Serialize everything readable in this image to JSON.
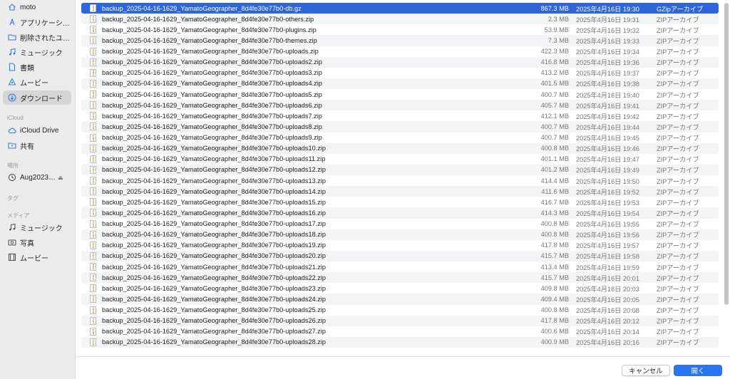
{
  "sidebar": {
    "favorites": [
      {
        "label": "moto",
        "icon": "home-icon"
      },
      {
        "label": "アプリケーシ…",
        "icon": "applications-icon"
      },
      {
        "label": "削除されたユ…",
        "icon": "folder-icon"
      },
      {
        "label": "ミュージック",
        "icon": "music-icon"
      },
      {
        "label": "書類",
        "icon": "document-icon"
      },
      {
        "label": "ムービー",
        "icon": "movies-icon"
      },
      {
        "label": "ダウンロード",
        "icon": "download-icon"
      }
    ],
    "icloud_title": "iCloud",
    "icloud": [
      {
        "label": "iCloud Drive",
        "icon": "cloud-icon"
      },
      {
        "label": "共有",
        "icon": "shared-folder-icon"
      }
    ],
    "locations_title": "場所",
    "locations": [
      {
        "label": "Aug2023…",
        "icon": "time-machine-icon"
      }
    ],
    "tags_title": "タグ",
    "media_title": "メディア",
    "media": [
      {
        "label": "ミュージック",
        "icon": "music-icon"
      },
      {
        "label": "写真",
        "icon": "camera-icon"
      },
      {
        "label": "ムービー",
        "icon": "film-icon"
      }
    ]
  },
  "files": [
    {
      "name": "backup_2025-04-16-1629_YamatoGeographer_8d4fe30e77b0-db.gz",
      "size": "867.3 MB",
      "date": "2025年4月16日 19:30",
      "kind": "GZipアーカイブ"
    },
    {
      "name": "backup_2025-04-16-1629_YamatoGeographer_8d4fe30e77b0-others.zip",
      "size": "2.3 MB",
      "date": "2025年4月16日 19:31",
      "kind": "ZIPアーカイブ"
    },
    {
      "name": "backup_2025-04-16-1629_YamatoGeographer_8d4fe30e77b0-plugins.zip",
      "size": "53.9 MB",
      "date": "2025年4月16日 19:32",
      "kind": "ZIPアーカイブ"
    },
    {
      "name": "backup_2025-04-16-1629_YamatoGeographer_8d4fe30e77b0-themes.zip",
      "size": "7.3 MB",
      "date": "2025年4月16日 19:33",
      "kind": "ZIPアーカイブ"
    },
    {
      "name": "backup_2025-04-16-1629_YamatoGeographer_8d4fe30e77b0-uploads.zip",
      "size": "422.3 MB",
      "date": "2025年4月16日 19:34",
      "kind": "ZIPアーカイブ"
    },
    {
      "name": "backup_2025-04-16-1629_YamatoGeographer_8d4fe30e77b0-uploads2.zip",
      "size": "416.8 MB",
      "date": "2025年4月16日 19:36",
      "kind": "ZIPアーカイブ"
    },
    {
      "name": "backup_2025-04-16-1629_YamatoGeographer_8d4fe30e77b0-uploads3.zip",
      "size": "413.2 MB",
      "date": "2025年4月16日 19:37",
      "kind": "ZIPアーカイブ"
    },
    {
      "name": "backup_2025-04-16-1629_YamatoGeographer_8d4fe30e77b0-uploads4.zip",
      "size": "401.5 MB",
      "date": "2025年4月16日 19:38",
      "kind": "ZIPアーカイブ"
    },
    {
      "name": "backup_2025-04-16-1629_YamatoGeographer_8d4fe30e77b0-uploads5.zip",
      "size": "400.7 MB",
      "date": "2025年4月16日 19:40",
      "kind": "ZIPアーカイブ"
    },
    {
      "name": "backup_2025-04-16-1629_YamatoGeographer_8d4fe30e77b0-uploads6.zip",
      "size": "405.7 MB",
      "date": "2025年4月16日 19:41",
      "kind": "ZIPアーカイブ"
    },
    {
      "name": "backup_2025-04-16-1629_YamatoGeographer_8d4fe30e77b0-uploads7.zip",
      "size": "412.1 MB",
      "date": "2025年4月16日 19:42",
      "kind": "ZIPアーカイブ"
    },
    {
      "name": "backup_2025-04-16-1629_YamatoGeographer_8d4fe30e77b0-uploads8.zip",
      "size": "400.7 MB",
      "date": "2025年4月16日 19:44",
      "kind": "ZIPアーカイブ"
    },
    {
      "name": "backup_2025-04-16-1629_YamatoGeographer_8d4fe30e77b0-uploads9.zip",
      "size": "400.7 MB",
      "date": "2025年4月16日 19:45",
      "kind": "ZIPアーカイブ"
    },
    {
      "name": "backup_2025-04-16-1629_YamatoGeographer_8d4fe30e77b0-uploads10.zip",
      "size": "400.8 MB",
      "date": "2025年4月16日 19:46",
      "kind": "ZIPアーカイブ"
    },
    {
      "name": "backup_2025-04-16-1629_YamatoGeographer_8d4fe30e77b0-uploads11.zip",
      "size": "401.1 MB",
      "date": "2025年4月16日 19:47",
      "kind": "ZIPアーカイブ"
    },
    {
      "name": "backup_2025-04-16-1629_YamatoGeographer_8d4fe30e77b0-uploads12.zip",
      "size": "401.2 MB",
      "date": "2025年4月16日 19:49",
      "kind": "ZIPアーカイブ"
    },
    {
      "name": "backup_2025-04-16-1629_YamatoGeographer_8d4fe30e77b0-uploads13.zip",
      "size": "414.4 MB",
      "date": "2025年4月16日 19:50",
      "kind": "ZIPアーカイブ"
    },
    {
      "name": "backup_2025-04-16-1629_YamatoGeographer_8d4fe30e77b0-uploads14.zip",
      "size": "411.6 MB",
      "date": "2025年4月16日 19:52",
      "kind": "ZIPアーカイブ"
    },
    {
      "name": "backup_2025-04-16-1629_YamatoGeographer_8d4fe30e77b0-uploads15.zip",
      "size": "416.7 MB",
      "date": "2025年4月16日 19:53",
      "kind": "ZIPアーカイブ"
    },
    {
      "name": "backup_2025-04-16-1629_YamatoGeographer_8d4fe30e77b0-uploads16.zip",
      "size": "414.3 MB",
      "date": "2025年4月16日 19:54",
      "kind": "ZIPアーカイブ"
    },
    {
      "name": "backup_2025-04-16-1629_YamatoGeographer_8d4fe30e77b0-uploads17.zip",
      "size": "400.8 MB",
      "date": "2025年4月16日 19:55",
      "kind": "ZIPアーカイブ"
    },
    {
      "name": "backup_2025-04-16-1629_YamatoGeographer_8d4fe30e77b0-uploads18.zip",
      "size": "400.8 MB",
      "date": "2025年4月16日 19:56",
      "kind": "ZIPアーカイブ"
    },
    {
      "name": "backup_2025-04-16-1629_YamatoGeographer_8d4fe30e77b0-uploads19.zip",
      "size": "417.8 MB",
      "date": "2025年4月16日 19:57",
      "kind": "ZIPアーカイブ"
    },
    {
      "name": "backup_2025-04-16-1629_YamatoGeographer_8d4fe30e77b0-uploads20.zip",
      "size": "415.7 MB",
      "date": "2025年4月16日 19:58",
      "kind": "ZIPアーカイブ"
    },
    {
      "name": "backup_2025-04-16-1629_YamatoGeographer_8d4fe30e77b0-uploads21.zip",
      "size": "413.4 MB",
      "date": "2025年4月16日 19:59",
      "kind": "ZIPアーカイブ"
    },
    {
      "name": "backup_2025-04-16-1629_YamatoGeographer_8d4fe30e77b0-uploads22.zip",
      "size": "415.7 MB",
      "date": "2025年4月16日 20:01",
      "kind": "ZIPアーカイブ"
    },
    {
      "name": "backup_2025-04-16-1629_YamatoGeographer_8d4fe30e77b0-uploads23.zip",
      "size": "409.8 MB",
      "date": "2025年4月16日 20:03",
      "kind": "ZIPアーカイブ"
    },
    {
      "name": "backup_2025-04-16-1629_YamatoGeographer_8d4fe30e77b0-uploads24.zip",
      "size": "409.4 MB",
      "date": "2025年4月16日 20:05",
      "kind": "ZIPアーカイブ"
    },
    {
      "name": "backup_2025-04-16-1629_YamatoGeographer_8d4fe30e77b0-uploads25.zip",
      "size": "400.8 MB",
      "date": "2025年4月16日 20:08",
      "kind": "ZIPアーカイブ"
    },
    {
      "name": "backup_2025-04-16-1629_YamatoGeographer_8d4fe30e77b0-uploads26.zip",
      "size": "417.8 MB",
      "date": "2025年4月16日 20:12",
      "kind": "ZIPアーカイブ"
    },
    {
      "name": "backup_2025-04-16-1629_YamatoGeographer_8d4fe30e77b0-uploads27.zip",
      "size": "400.6 MB",
      "date": "2025年4月16日 20:14",
      "kind": "ZIPアーカイブ"
    },
    {
      "name": "backup_2025-04-16-1629_YamatoGeographer_8d4fe30e77b0-uploads28.zip",
      "size": "400.9 MB",
      "date": "2025年4月16日 20:16",
      "kind": "ZIPアーカイブ"
    }
  ],
  "buttons": {
    "cancel": "キャンセル",
    "open": "開く"
  },
  "colors": {
    "selection": "#2e65d9",
    "primary_button": "#2b75f0",
    "sidebar_bg": "#ececec"
  }
}
